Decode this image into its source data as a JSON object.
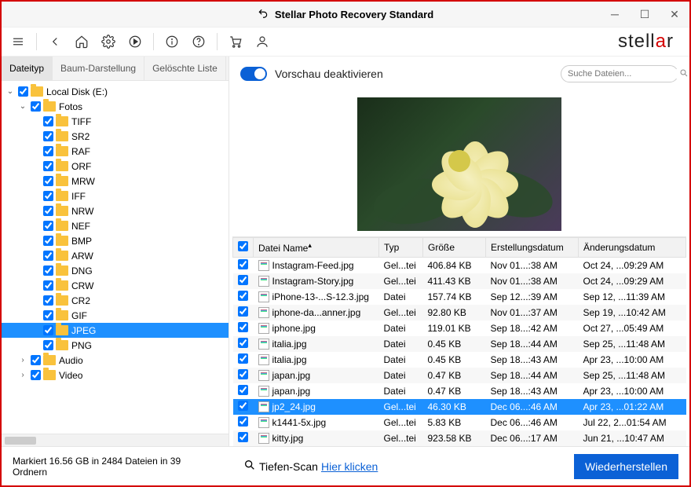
{
  "title": "Stellar Photo Recovery Standard",
  "brand_plain": "stell",
  "brand_accent": "a",
  "brand_tail": "r",
  "tabs": {
    "dateityp": "Dateityp",
    "baum": "Baum-Darstellung",
    "geloeschte": "Gelöschte Liste"
  },
  "preview_toggle_label": "Vorschau deaktivieren",
  "search_placeholder": "Suche Dateien...",
  "tree": {
    "root": "Local Disk (E:)",
    "fotos": "Fotos",
    "types": [
      "TIFF",
      "SR2",
      "RAF",
      "ORF",
      "MRW",
      "IFF",
      "NRW",
      "NEF",
      "BMP",
      "ARW",
      "DNG",
      "CRW",
      "CR2",
      "GIF",
      "JPEG",
      "PNG"
    ],
    "selected": "JPEG",
    "audio": "Audio",
    "video": "Video"
  },
  "table": {
    "headers": {
      "name": "Datei Name",
      "typ": "Typ",
      "groesse": "Größe",
      "erstell": "Erstellungsdatum",
      "aender": "Änderungsdatum"
    },
    "rows": [
      {
        "name": "Instagram-Feed.jpg",
        "typ": "Gel...tei",
        "size": "406.84 KB",
        "cd": "Nov 01...:38 AM",
        "md": "Oct 24, ...09:29 AM"
      },
      {
        "name": "Instagram-Story.jpg",
        "typ": "Gel...tei",
        "size": "411.43 KB",
        "cd": "Nov 01...:38 AM",
        "md": "Oct 24, ...09:29 AM"
      },
      {
        "name": "iPhone-13-...S-12.3.jpg",
        "typ": "Datei",
        "size": "157.74 KB",
        "cd": "Sep 12...:39 AM",
        "md": "Sep 12, ...11:39 AM"
      },
      {
        "name": "iphone-da...anner.jpg",
        "typ": "Gel...tei",
        "size": "92.80 KB",
        "cd": "Nov 01...:37 AM",
        "md": "Sep 19, ...10:42 AM"
      },
      {
        "name": "iphone.jpg",
        "typ": "Datei",
        "size": "119.01 KB",
        "cd": "Sep 18...:42 AM",
        "md": "Oct 27, ...05:49 AM"
      },
      {
        "name": "italia.jpg",
        "typ": "Datei",
        "size": "0.45 KB",
        "cd": "Sep 18...:44 AM",
        "md": "Sep 25, ...11:48 AM"
      },
      {
        "name": "italia.jpg",
        "typ": "Datei",
        "size": "0.45 KB",
        "cd": "Sep 18...:43 AM",
        "md": "Apr 23, ...10:00 AM"
      },
      {
        "name": "japan.jpg",
        "typ": "Datei",
        "size": "0.47 KB",
        "cd": "Sep 18...:44 AM",
        "md": "Sep 25, ...11:48 AM"
      },
      {
        "name": "japan.jpg",
        "typ": "Datei",
        "size": "0.47 KB",
        "cd": "Sep 18...:43 AM",
        "md": "Apr 23, ...10:00 AM"
      },
      {
        "name": "jp2_24.jpg",
        "typ": "Gel...tei",
        "size": "46.30 KB",
        "cd": "Dec 06...:46 AM",
        "md": "Apr 23, ...01:22 AM",
        "selected": true
      },
      {
        "name": "k1441-5x.jpg",
        "typ": "Gel...tei",
        "size": "5.83 KB",
        "cd": "Dec 06...:46 AM",
        "md": "Jul 22, 2...01:54 AM"
      },
      {
        "name": "kitty.jpg",
        "typ": "Gel...tei",
        "size": "923.58 KB",
        "cd": "Dec 06...:17 AM",
        "md": "Jun 21, ...10:47 AM"
      }
    ]
  },
  "footer": {
    "status": "Markiert 16.56 GB in 2484 Dateien in 39 Ordnern",
    "deepscan_label": "Tiefen-Scan",
    "deepscan_link": "Hier klicken",
    "restore": "Wiederherstellen"
  }
}
